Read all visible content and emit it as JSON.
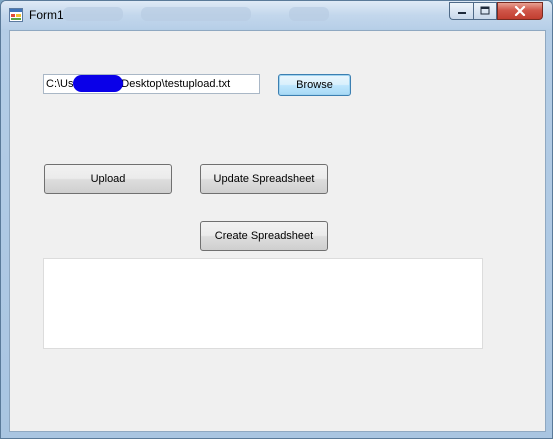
{
  "window": {
    "title": "Form1",
    "minimize_label": "minimize",
    "maximize_label": "maximize",
    "close_label": "close"
  },
  "form": {
    "file_path": {
      "prefix": "C:\\User",
      "suffix": "Desktop\\testupload.txt"
    },
    "browse_label": "Browse",
    "upload_label": "Upload",
    "update_label": "Update Spreadsheet",
    "create_label": "Create Spreadsheet"
  },
  "icons": {
    "app": "form-app-icon",
    "minimize": "minimize-icon",
    "maximize": "maximize-icon",
    "close": "close-icon"
  },
  "colors": {
    "redaction": "#0a00e8",
    "close_button": "#c13d2f",
    "client_background": "#f0f0f0"
  }
}
